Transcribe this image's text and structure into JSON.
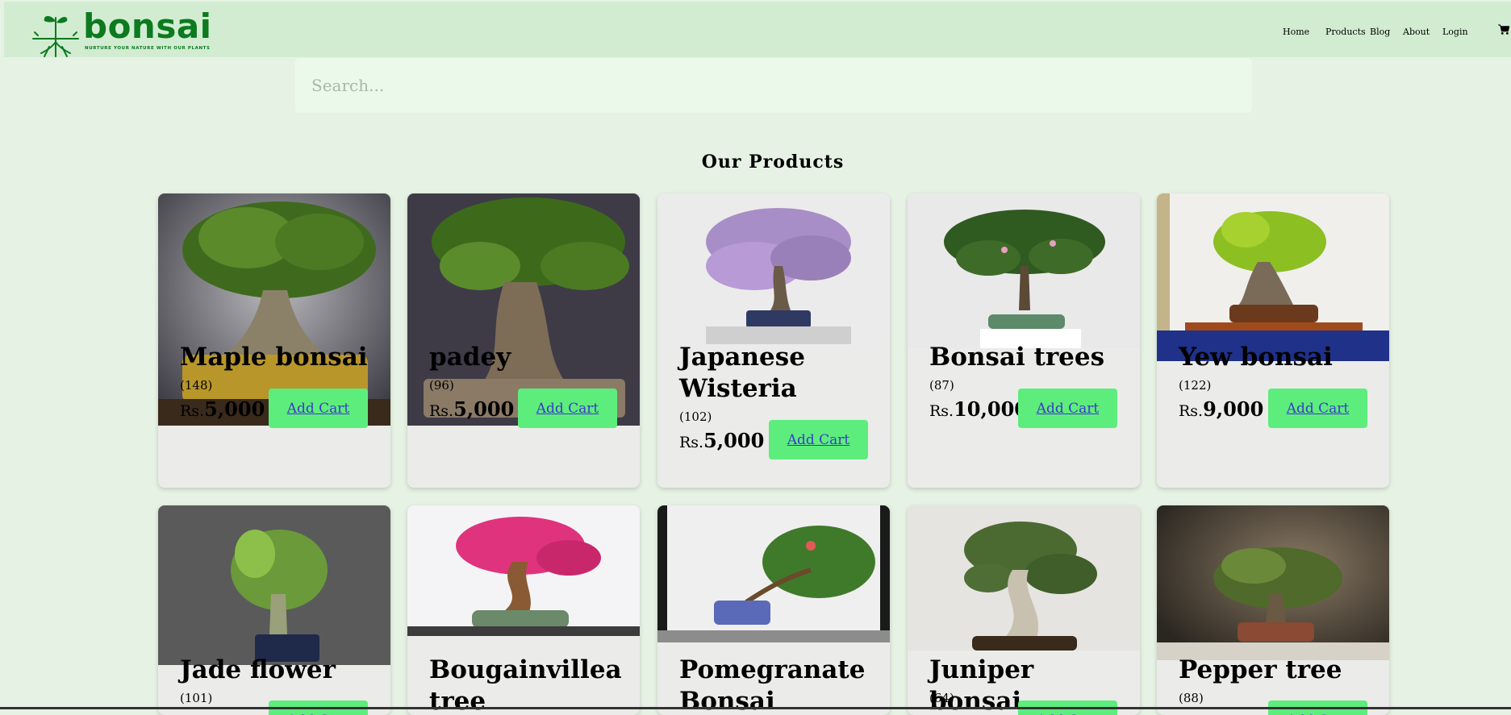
{
  "brand": {
    "name": "bonsai",
    "tagline": "NURTURE YOUR NATURE WITH OUR PLANTS",
    "color": "#0c7a1e"
  },
  "nav": {
    "home": "Home",
    "products": "Products",
    "blog": "Blog",
    "about": "About",
    "login": "Login",
    "cart_icon": "cart-icon"
  },
  "search": {
    "placeholder": "Search..."
  },
  "section": {
    "title": "Our Products"
  },
  "colors": {
    "header_bg": "#d2ecd2",
    "page_bg": "#e6f3e4",
    "button_bg": "#5ded7d",
    "card_bg": "#ebebe9"
  },
  "products": [
    {
      "name": "Maple bonsai",
      "count": "(148)",
      "currency": "Rs.",
      "price": "5,000",
      "button": "Add Cart"
    },
    {
      "name": "padey",
      "count": "(96)",
      "currency": "Rs.",
      "price": "5,000",
      "button": "Add Cart"
    },
    {
      "name": "Japanese Wisteria",
      "count": "(102)",
      "currency": "Rs.",
      "price": "5,000",
      "button": "Add Cart"
    },
    {
      "name": "Bonsai trees",
      "count": "(87)",
      "currency": "Rs.",
      "price": "10,000",
      "button": "Add Cart"
    },
    {
      "name": "Yew bonsai",
      "count": "(122)",
      "currency": "Rs.",
      "price": "9,000",
      "button": "Add Cart"
    },
    {
      "name": "Jade flower",
      "count": "(101)",
      "button": "Add Cart"
    },
    {
      "name": "Bougainvillea tree",
      "count": ""
    },
    {
      "name": "Pomegranate Bonsai",
      "count": ""
    },
    {
      "name": "Juniper bonsai",
      "count": "(64)",
      "button": "Add Cart"
    },
    {
      "name": "Pepper tree",
      "count": "(88)",
      "button": "Add Cart"
    }
  ]
}
